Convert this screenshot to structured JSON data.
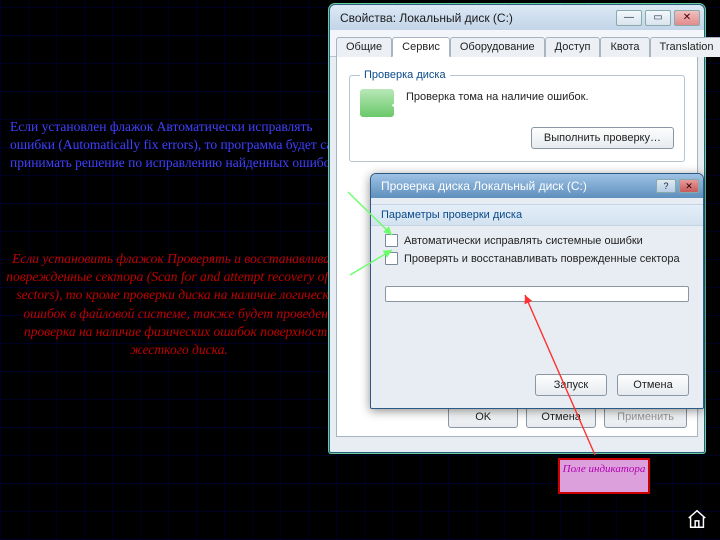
{
  "para1": "Если установлен флажок Автоматически исправлять ошибки (Automatically fix errors), то программа будет сама принимать решение по исправлению найденных ошибок.",
  "para2": "Если установить флажок Проверять и восстанавливать поврежденные сектора (Scan for and attempt recovery of bad sectors), то кроме проверки диска на наличие логических ошибок в файловой системе, также будет проведена проверка на наличие физических ошибок поверхности жесткого диска.",
  "indicator_label": "Поле индикатора",
  "props": {
    "title": "Свойства: Локальный диск (C:)",
    "tabs": [
      "Общие",
      "Сервис",
      "Оборудование",
      "Доступ",
      "Квота",
      "Translation"
    ],
    "active_tab_index": 1,
    "group_check": {
      "legend": "Проверка диска",
      "text": "Проверка тома на наличие ошибок.",
      "button": "Выполнить проверку…"
    },
    "buttons": {
      "ok": "OK",
      "cancel": "Отмена",
      "apply": "Применить"
    }
  },
  "check": {
    "title": "Проверка диска Локальный диск (C:)",
    "group": "Параметры проверки диска",
    "opts": [
      "Автоматически исправлять системные ошибки",
      "Проверять и восстанавливать поврежденные сектора"
    ],
    "start": "Запуск",
    "cancel": "Отмена"
  }
}
